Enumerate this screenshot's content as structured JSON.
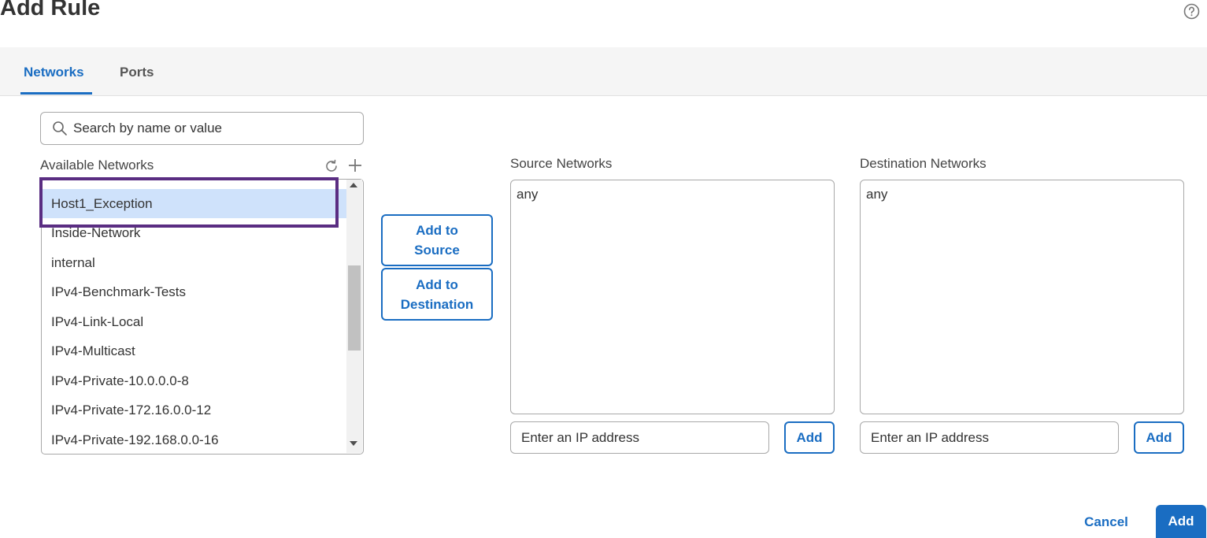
{
  "dialog": {
    "title": "Add Rule"
  },
  "tabs": [
    {
      "label": "Networks",
      "active": true
    },
    {
      "label": "Ports",
      "active": false
    }
  ],
  "search": {
    "placeholder": "Search by name or value",
    "value": ""
  },
  "available": {
    "label": "Available Networks",
    "items": [
      "Host1_Exception",
      "Inside-Network",
      "internal",
      "IPv4-Benchmark-Tests",
      "IPv4-Link-Local",
      "IPv4-Multicast",
      "IPv4-Private-10.0.0.0-8",
      "IPv4-Private-172.16.0.0-12",
      "IPv4-Private-192.168.0.0-16"
    ],
    "selected": "Host1_Exception"
  },
  "actions": {
    "add_to_source": "Add to Source",
    "add_to_source_lines": [
      "Add to",
      "Source"
    ],
    "add_to_destination": "Add to Destination",
    "add_to_destination_lines": [
      "Add to",
      "Destination"
    ]
  },
  "source": {
    "label": "Source Networks",
    "content": "any",
    "ip_placeholder": "Enter an IP address",
    "add_label": "Add"
  },
  "destination": {
    "label": "Destination Networks",
    "content": "any",
    "ip_placeholder": "Enter an IP address",
    "add_label": "Add"
  },
  "footer": {
    "cancel_label": "Cancel",
    "add_label": "Add"
  },
  "colors": {
    "accent": "#1a6dc2",
    "highlight_border": "#5a2d82",
    "selected_row": "#cfe2fb"
  },
  "icons": {
    "help": "help-icon",
    "search": "search-icon",
    "refresh": "refresh-icon",
    "add": "plus-icon"
  }
}
